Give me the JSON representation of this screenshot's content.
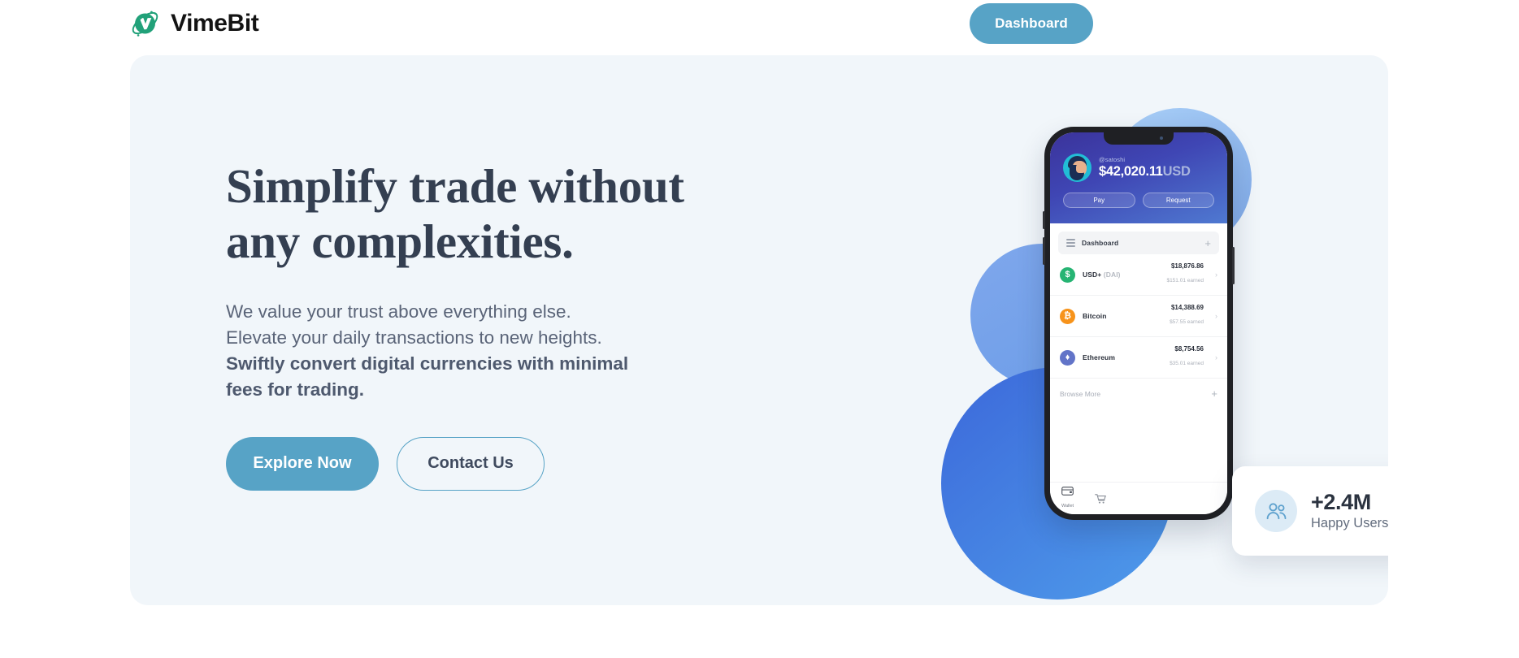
{
  "header": {
    "brand_name": "VimeBit",
    "brand_icon": "globe-v-logo-icon",
    "dashboard_label": "Dashboard"
  },
  "hero": {
    "title_line1": "Simplify trade without",
    "title_line2": "any complexities.",
    "sub_line1": "We value your trust above everything else.",
    "sub_line2": "Elevate your daily transactions to new heights.",
    "sub_line3": "Swiftly convert digital currencies with minimal",
    "sub_line4": "fees for trading.",
    "primary_cta": "Explore Now",
    "secondary_cta": "Contact Us"
  },
  "phone": {
    "account": {
      "handle": "@satoshi",
      "balance": "$42,020.11",
      "currency": "USD",
      "avatar_icon": "user-avatar"
    },
    "actions": [
      {
        "label": "Pay"
      },
      {
        "label": "Request"
      }
    ],
    "dashboard_bar": {
      "menu_icon": "hamburger-icon",
      "label": "Dashboard",
      "add_icon": "plus-icon"
    },
    "assets": [
      {
        "name": "USD+",
        "ticker": "(DAI)",
        "amount": "$18,876.86",
        "earned": "$151.01 earned",
        "icon": "usd-coin-icon",
        "color": "#26B473"
      },
      {
        "name": "Bitcoin",
        "ticker": "",
        "amount": "$14,388.69",
        "earned": "$57.55 earned",
        "icon": "bitcoin-icon",
        "color": "#F7931A"
      },
      {
        "name": "Ethereum",
        "ticker": "",
        "amount": "$8,754.56",
        "earned": "$35.01 earned",
        "icon": "ethereum-icon",
        "color": "#6274C8"
      }
    ],
    "browse_more": {
      "label": "Browse More",
      "add_icon": "plus-icon"
    },
    "tabs": [
      {
        "label": "Wallet",
        "icon": "credit-card-icon"
      },
      {
        "label": "",
        "icon": "cart-icon"
      }
    ]
  },
  "stats_card": {
    "icon": "people-icon",
    "count": "+2.4M",
    "label": "Happy Users"
  },
  "colors": {
    "accent_blue": "#57A3C6",
    "brand_green": "#21A179",
    "heading": "#343F51",
    "hero_bg": "#F1F6FA",
    "page_bg": "#FFFFFF"
  }
}
